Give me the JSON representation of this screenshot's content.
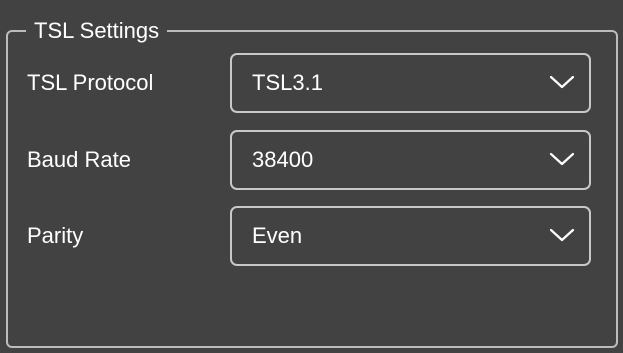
{
  "group": {
    "title": "TSL Settings"
  },
  "fields": [
    {
      "label": "TSL Protocol",
      "value": "TSL3.1",
      "icon": "chevron-down-icon"
    },
    {
      "label": "Baud Rate",
      "value": "38400",
      "icon": "chevron-down-icon"
    },
    {
      "label": "Parity",
      "value": "Even",
      "icon": "chevron-down-icon"
    }
  ],
  "colors": {
    "background": "#424242",
    "border": "#bcbcbc",
    "text": "#ffffff"
  }
}
